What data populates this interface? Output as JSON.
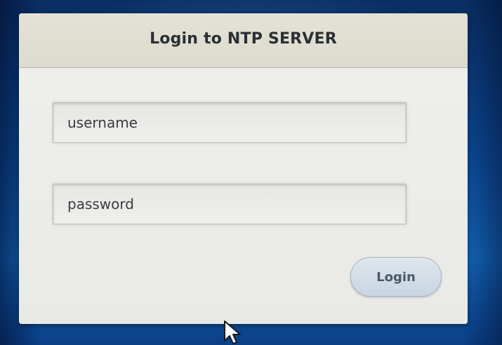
{
  "dialog": {
    "title": "Login to NTP SERVER"
  },
  "form": {
    "username": {
      "value": "",
      "placeholder": "username"
    },
    "password": {
      "value": "",
      "placeholder": "password"
    },
    "login_label": "Login"
  },
  "colors": {
    "desktop_background": "#0d4c99",
    "dialog_background": "#ececea",
    "header_background": "#e0ded1",
    "button_background": "#d3dde6",
    "button_text": "#4a5a68",
    "title_text": "#2a2f33"
  },
  "icons": {
    "cursor": "mouse-pointer-icon"
  }
}
